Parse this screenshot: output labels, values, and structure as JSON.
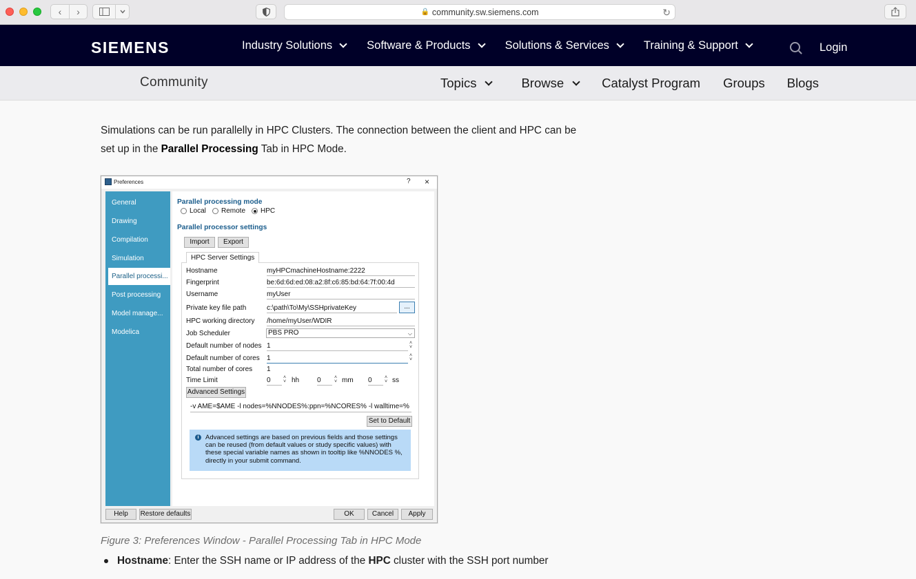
{
  "browser": {
    "url": "community.sw.siemens.com"
  },
  "header": {
    "logo": "SIEMENS",
    "nav": [
      "Industry Solutions",
      "Software & Products",
      "Solutions & Services",
      "Training & Support"
    ],
    "login": "Login"
  },
  "subnav": {
    "title": "Community",
    "items": [
      "Topics",
      "Browse",
      "Catalyst Program",
      "Groups",
      "Blogs"
    ]
  },
  "article": {
    "para_1": "Simulations can be run parallelly in HPC Clusters. The connection between the client and HPC can be",
    "para_2a": "set up in the ",
    "para_2b": "Parallel Processing",
    "para_2c": " Tab in HPC Mode.",
    "caption": "Figure 3: Preferences Window - Parallel Processing Tab in HPC Mode",
    "bullet_bold_1": "Hostname",
    "bullet_text_1": ": Enter the SSH name or IP address of the ",
    "bullet_bold_2": "HPC",
    "bullet_text_2": " cluster with the SSH port number"
  },
  "dialog": {
    "title": "Preferences",
    "help": "?",
    "close": "×",
    "sidebar": [
      "General",
      "Drawing",
      "Compilation",
      "Simulation",
      "Parallel processi...",
      "Post processing",
      "Model manage...",
      "Modelica"
    ],
    "mode_header": "Parallel processing mode",
    "modes": [
      "Local",
      "Remote",
      "HPC"
    ],
    "selected_mode": "HPC",
    "settings_header": "Parallel processor settings",
    "import": "Import",
    "export": "Export",
    "tab": "HPC Server Settings",
    "fields": {
      "hostname_label": "Hostname",
      "hostname": "myHPCmachineHostname:2222",
      "fingerprint_label": "Fingerprint",
      "fingerprint": "be:6d:6d:ed:08:a2:8f:c6:85:bd:64:7f:00:4d",
      "username_label": "Username",
      "username": "myUser",
      "keypath_label": "Private key file path",
      "keypath": "c:\\path\\To\\My\\SSHprivateKey",
      "browse": "...",
      "workdir_label": "HPC working directory",
      "workdir": "/home/myUser/WDIR",
      "scheduler_label": "Job Scheduler",
      "scheduler": "PBS PRO",
      "nodes_label": "Default number of nodes",
      "nodes": "1",
      "cores_label": "Default number of cores",
      "cores": "1",
      "total_label": "Total number of cores",
      "total": "1",
      "time_label": "Time Limit",
      "hh": "0",
      "mm": "0",
      "ss": "0",
      "hh_unit": "hh",
      "mm_unit": "mm",
      "ss_unit": "ss"
    },
    "advanced": "Advanced Settings",
    "command": "-v AME=$AME -l nodes=%NNODES%:ppn=%NCORES% -l walltime=%",
    "set_default": "Set to Default",
    "info": "Advanced settings are based on previous fields and those settings can be reused (from default values or study specific values) with these special variable names as shown in tooltip like %NNODES %, directly in your submit command.",
    "bottom": {
      "help": "Help",
      "restore": "Restore defaults",
      "ok": "OK",
      "cancel": "Cancel",
      "apply": "Apply"
    }
  }
}
